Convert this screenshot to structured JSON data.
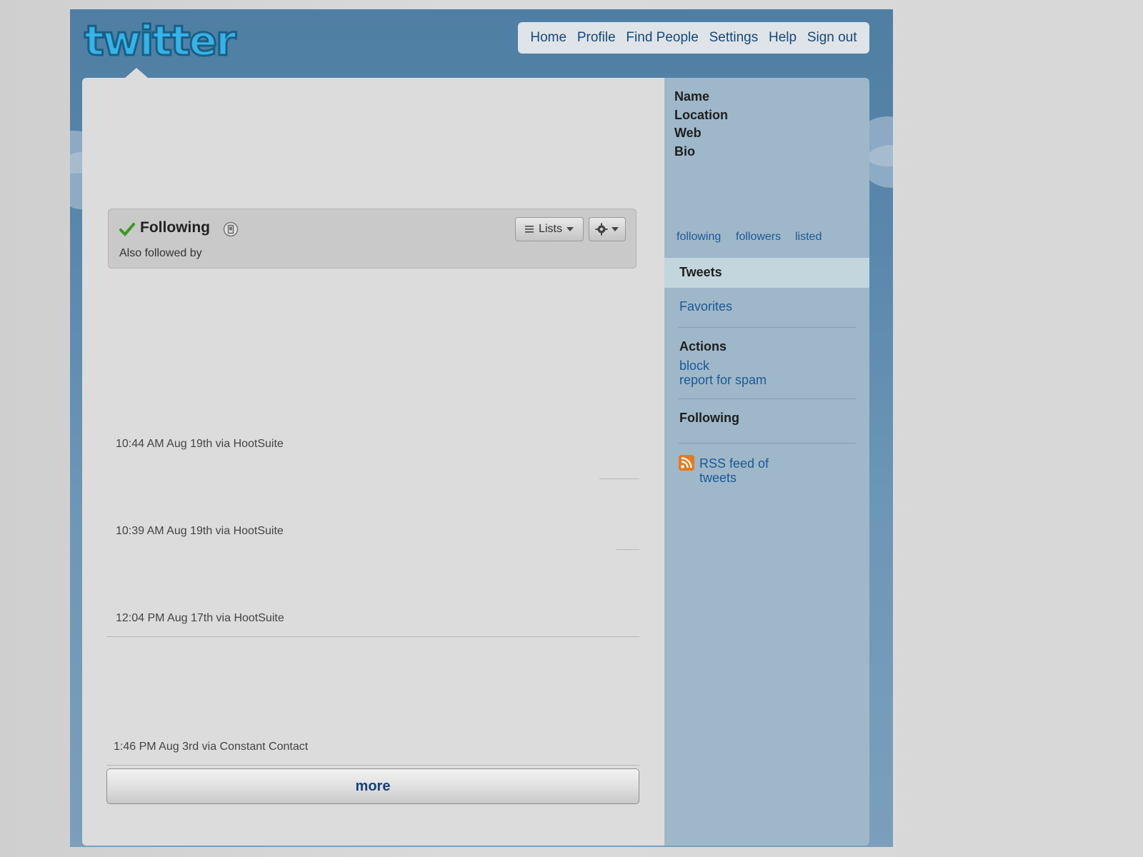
{
  "brand": {
    "logo_text": "twitter"
  },
  "topnav": {
    "items": [
      {
        "label": "Home"
      },
      {
        "label": "Profile"
      },
      {
        "label": "Find People"
      },
      {
        "label": "Settings"
      },
      {
        "label": "Help"
      },
      {
        "label": "Sign out"
      }
    ]
  },
  "follow_box": {
    "status": "Following",
    "also_followed": "Also followed by",
    "lists_label": "Lists"
  },
  "tweets": [
    {
      "meta": "10:44 AM Aug 19th via HootSuite"
    },
    {
      "meta": "10:39 AM Aug 19th via HootSuite"
    },
    {
      "meta": "12:04 PM Aug 17th via HootSuite"
    },
    {
      "meta": "1:46 PM Aug 3rd via Constant Contact"
    }
  ],
  "more_label": "more",
  "sidebar": {
    "profile_fields": {
      "name": "Name",
      "location": "Location",
      "web": "Web",
      "bio": "Bio"
    },
    "stats": {
      "following": "following",
      "followers": "followers",
      "listed": "listed"
    },
    "tweets_tab": "Tweets",
    "favorites": "Favorites",
    "actions_heading": "Actions",
    "block": "block",
    "report_spam": "report for spam",
    "following_heading": "Following",
    "rss_line1": "RSS feed of",
    "rss_line2": "tweets"
  },
  "colors": {
    "link": "#1d5894",
    "nav_text": "#16487a",
    "frame_bg": "#5a89ad",
    "sidebar_bg": "#9eb8ca",
    "check_green": "#3a9a1e",
    "rss_orange": "#e8781e"
  }
}
